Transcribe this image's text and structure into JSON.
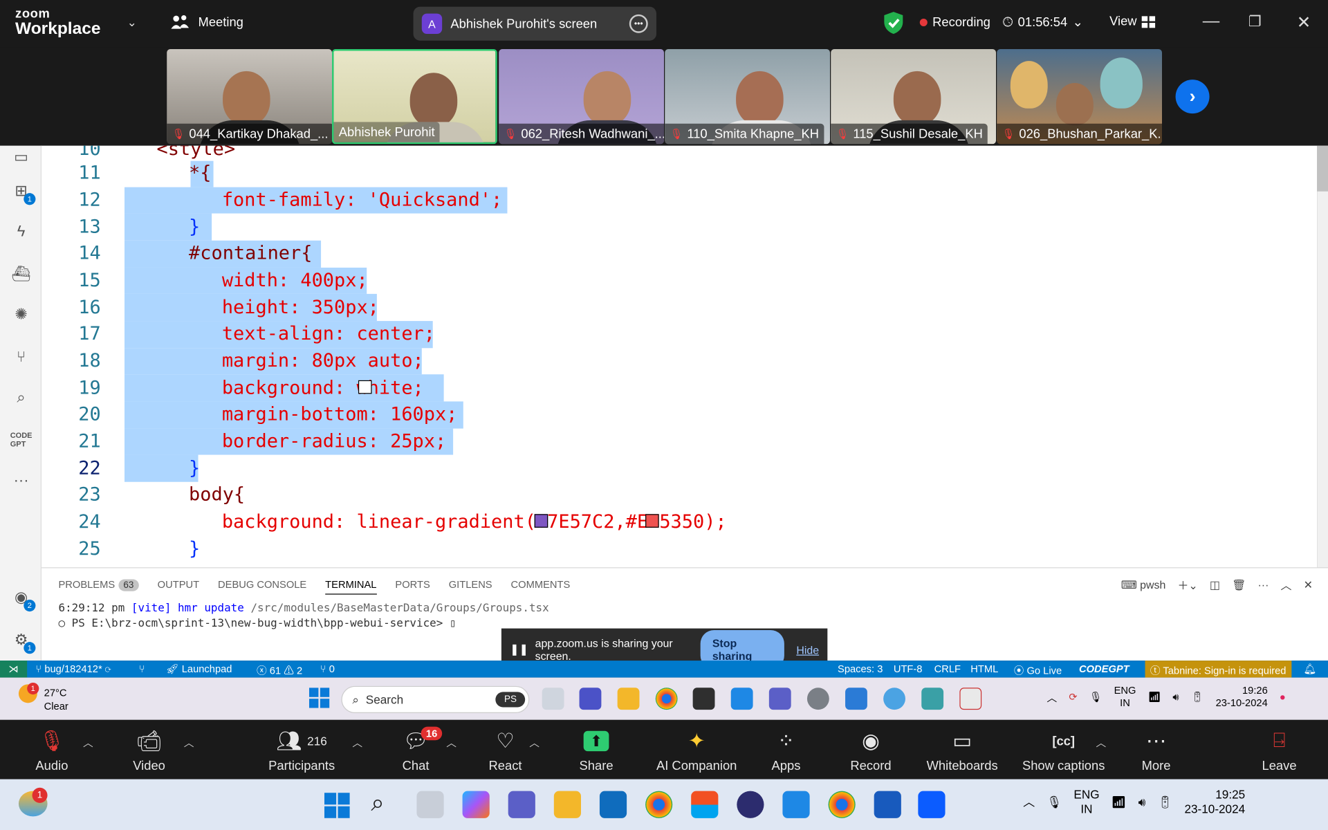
{
  "topbar": {
    "logo_line1": "zoom",
    "logo_line2": "Workplace",
    "meeting_label": "Meeting",
    "share_initial": "A",
    "share_label": "Abhishek Purohit's screen",
    "recording_label": "Recording",
    "timer": "01:56:54",
    "view_label": "View"
  },
  "participants": [
    {
      "name": "044_Kartikay Dhakad_...",
      "muted": true
    },
    {
      "name": "Abhishek Purohit",
      "muted": false,
      "active": true
    },
    {
      "name": "062_Ritesh Wadhwani_...",
      "muted": true
    },
    {
      "name": "110_Smita Khapne_KH",
      "muted": true
    },
    {
      "name": "115_Sushil Desale_KH",
      "muted": true
    },
    {
      "name": "026_Bhushan_Parkar_K...",
      "muted": true
    }
  ],
  "editor": {
    "partial_top_line": {
      "num": "10",
      "text": "<style>"
    },
    "lines": [
      {
        "num": "11",
        "text": "*{"
      },
      {
        "num": "12",
        "text": "font-family: 'Quicksand';"
      },
      {
        "num": "13",
        "text": "}"
      },
      {
        "num": "14",
        "text": "#container{"
      },
      {
        "num": "15",
        "text": "width: 400px;"
      },
      {
        "num": "16",
        "text": "height: 350px;"
      },
      {
        "num": "17",
        "text": "text-align: center;"
      },
      {
        "num": "18",
        "text": "margin: 80px auto;"
      },
      {
        "num": "19",
        "text": "background: white;"
      },
      {
        "num": "20",
        "text": "margin-bottom: 160px;"
      },
      {
        "num": "21",
        "text": "border-radius: 25px;"
      },
      {
        "num": "22",
        "text": "}"
      },
      {
        "num": "23",
        "text": "body{"
      },
      {
        "num": "24",
        "text": "background: linear-gradient(#7E57C2,#EF5350);"
      },
      {
        "num": "25",
        "text": "}"
      }
    ],
    "swatch_colors": {
      "white": "#FFFFFF",
      "purple": "#7E57C2",
      "red": "#EF5350"
    },
    "activity_badges": {
      "extensions": "1",
      "accounts": "2",
      "settings": "1"
    }
  },
  "panel": {
    "tabs": [
      "PROBLEMS",
      "OUTPUT",
      "DEBUG CONSOLE",
      "TERMINAL",
      "PORTS",
      "GITLENS",
      "COMMENTS"
    ],
    "problems_count": "63",
    "active_tab": "TERMINAL",
    "shell_label": "pwsh",
    "terminal_line1_time": "6:29:12 pm",
    "terminal_line1_cmd": "[vite] hmr update",
    "terminal_line1_path": "/src/modules/BaseMasterData/Groups/Groups.tsx",
    "terminal_line2": "PS E:\\brz-ocm\\sprint-13\\new-bug-width\\bpp-webui-service>"
  },
  "share_notice": {
    "text": "app.zoom.us is sharing your screen.",
    "stop_label": "Stop sharing",
    "hide_label": "Hide"
  },
  "statusbar": {
    "branch": "bug/182412*",
    "launchpad": "Launchpad",
    "errors": "61",
    "warnings": "2",
    "ports": "0",
    "spaces": "Spaces: 3",
    "encoding": "UTF-8",
    "eol": "CRLF",
    "language": "HTML",
    "golive": "Go Live",
    "codegpt": "CODEGPT",
    "tabnine": "Tabnine: Sign-in is required"
  },
  "inner_taskbar": {
    "weather_badge": "1",
    "temp": "27°C",
    "condition": "Clear",
    "search_placeholder": "Search",
    "lang1": "ENG",
    "lang2": "IN",
    "time": "19:26",
    "date": "23-10-2024"
  },
  "zoom_toolbar": {
    "audio": "Audio",
    "video": "Video",
    "participants": "Participants",
    "participants_count": "216",
    "chat": "Chat",
    "chat_badge": "16",
    "react": "React",
    "share": "Share",
    "ai": "AI Companion",
    "apps": "Apps",
    "record": "Record",
    "whiteboards": "Whiteboards",
    "captions": "Show captions",
    "more": "More",
    "leave": "Leave"
  },
  "outer_taskbar": {
    "weather_badge": "1",
    "lang1": "ENG",
    "lang2": "IN",
    "time": "19:25",
    "date": "23-10-2024"
  }
}
